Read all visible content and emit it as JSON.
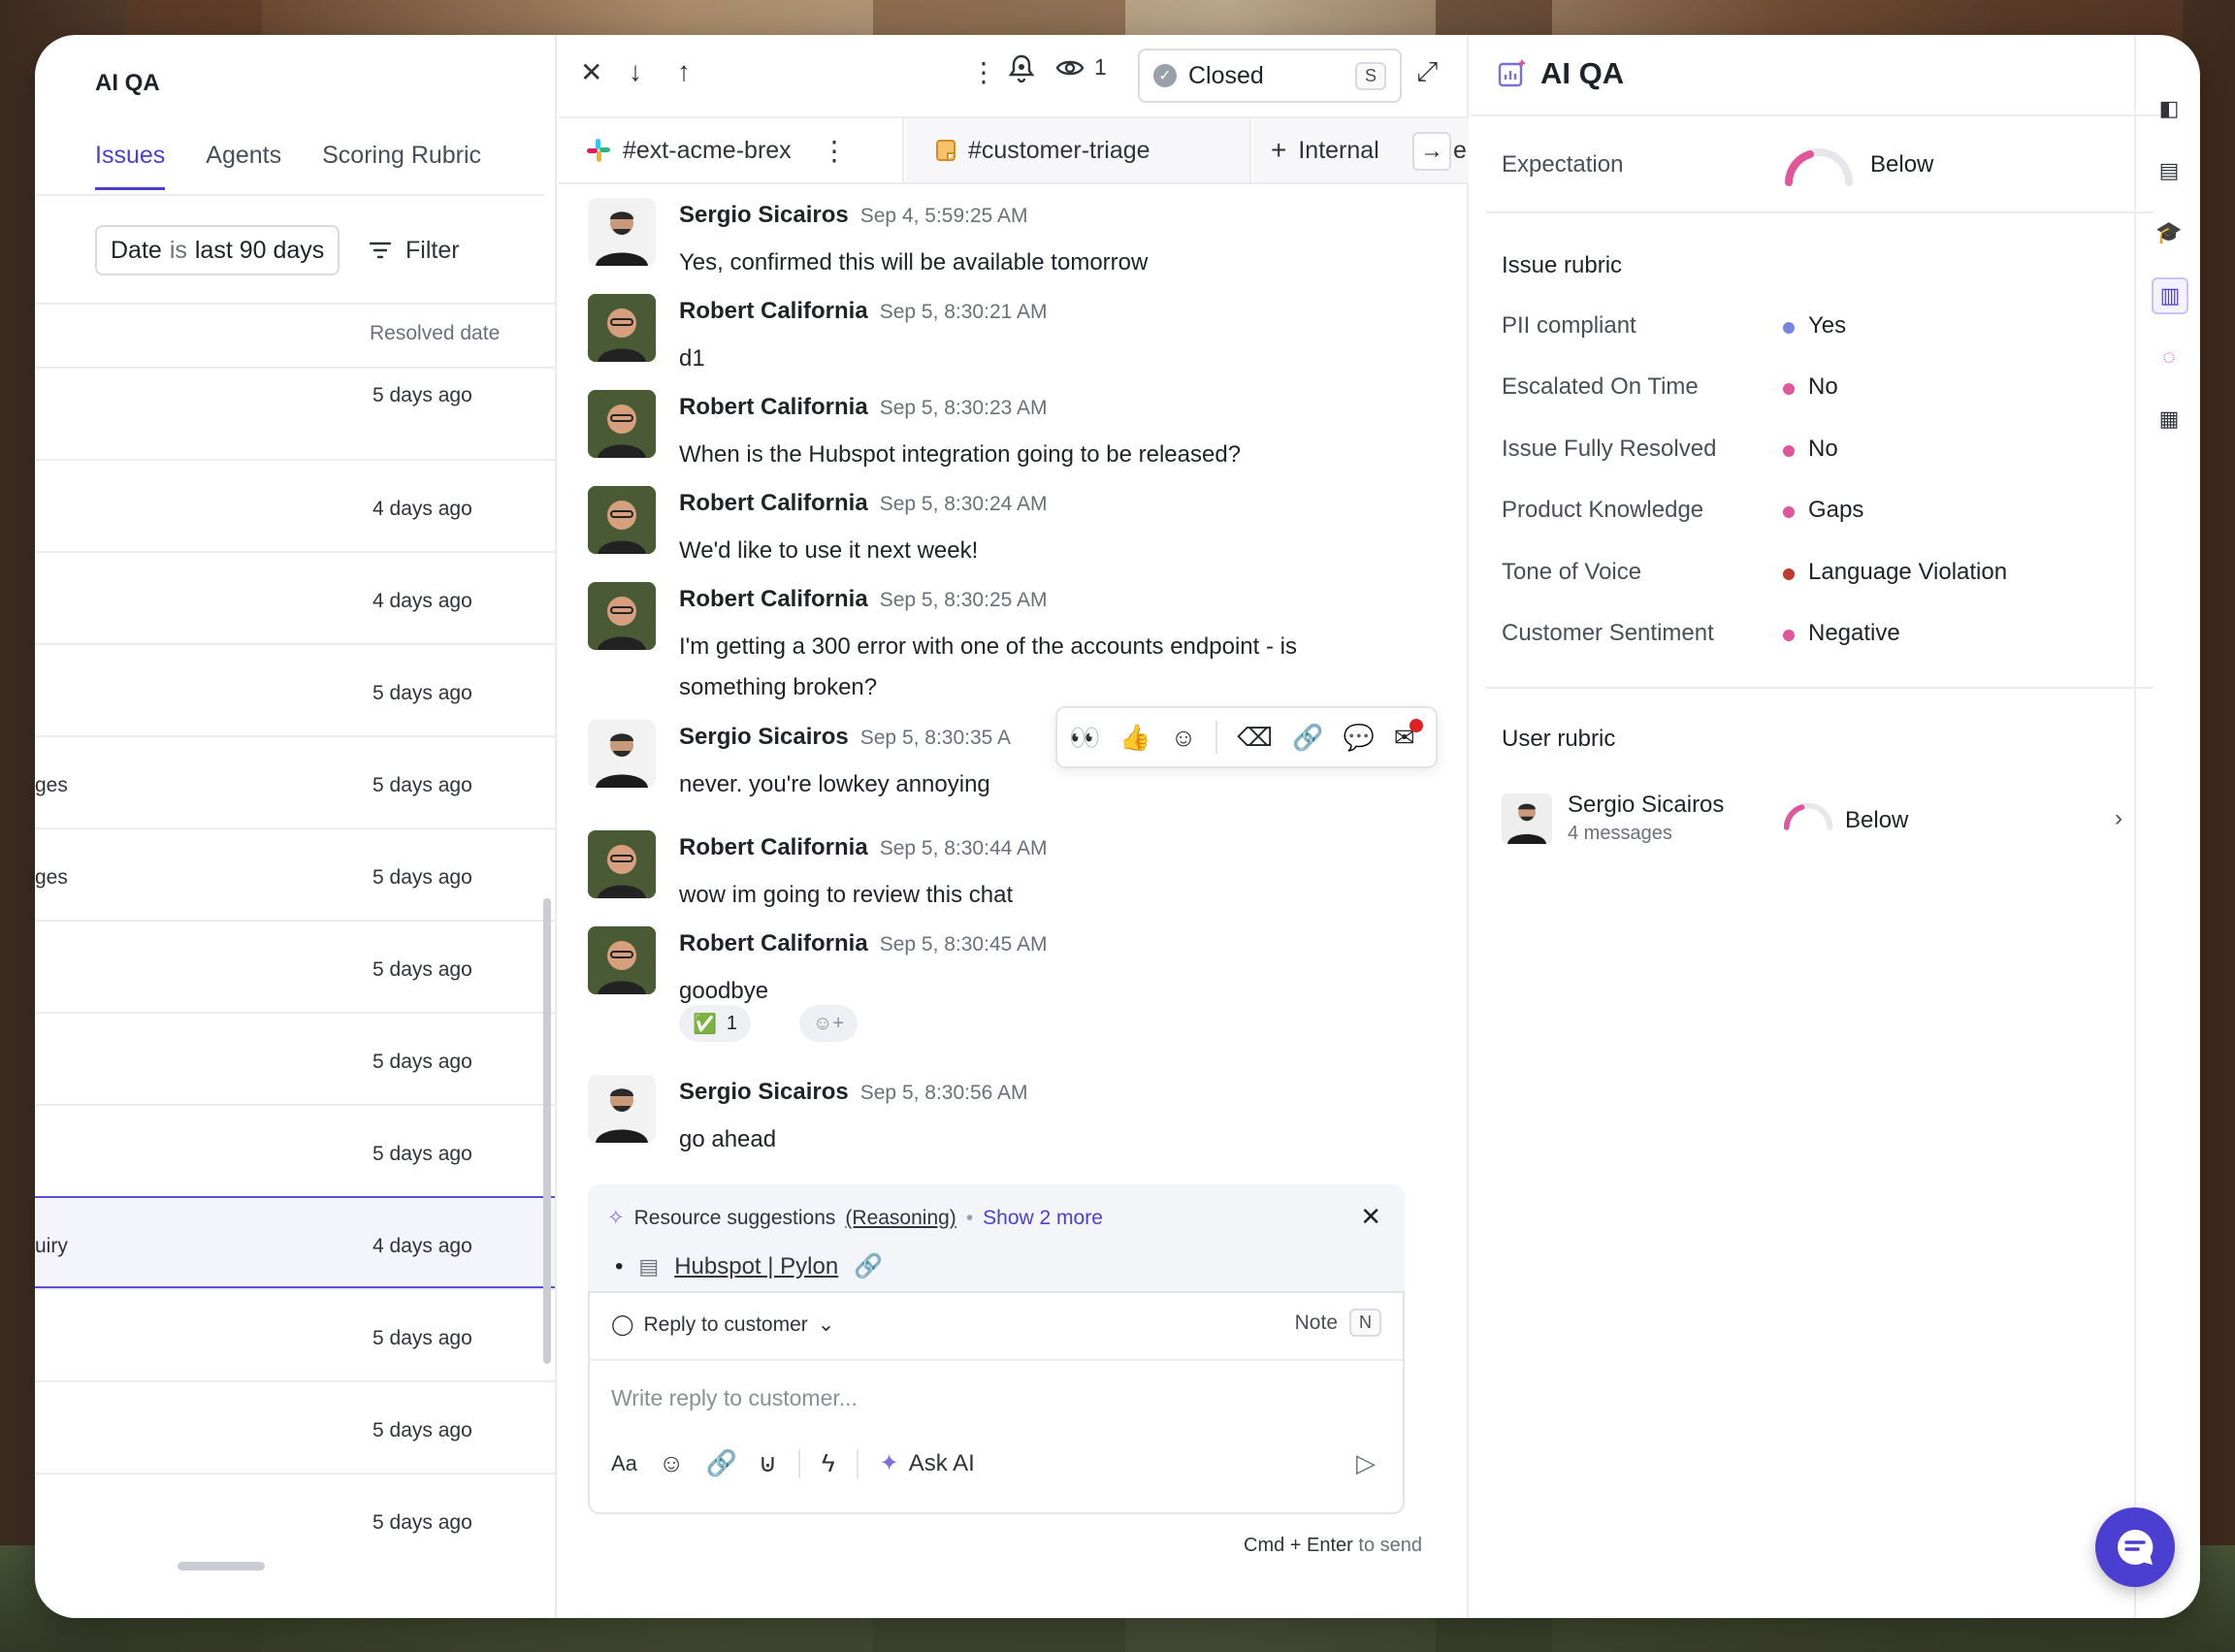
{
  "left": {
    "title": "AI QA",
    "tabs": [
      "Issues",
      "Agents",
      "Scoring Rubric"
    ],
    "date_filter": {
      "field": "Date",
      "op": "is",
      "value": "last 90 days"
    },
    "filter_label": "Filter",
    "column_header": "Resolved date",
    "rows": [
      {
        "frag": "",
        "date": "5 days ago"
      },
      {
        "frag": "",
        "date": "4 days ago"
      },
      {
        "frag": "",
        "date": "4 days ago"
      },
      {
        "frag": "",
        "date": "5 days ago"
      },
      {
        "frag": "ges",
        "date": "5 days ago"
      },
      {
        "frag": "ges",
        "date": "5 days ago"
      },
      {
        "frag": "",
        "date": "5 days ago"
      },
      {
        "frag": "",
        "date": "5 days ago"
      },
      {
        "frag": "",
        "date": "5 days ago"
      },
      {
        "frag": "uiry",
        "date": "4 days ago"
      },
      {
        "frag": "",
        "date": "5 days ago"
      },
      {
        "frag": "",
        "date": "5 days ago"
      },
      {
        "frag": "",
        "date": "5 days ago"
      }
    ]
  },
  "toolbar": {
    "watchers": "1",
    "status": "Closed",
    "status_kbd": "S"
  },
  "channel_tabs": [
    "#ext-acme-brex",
    "#customer-triage",
    "Internal"
  ],
  "internal_tail": "e",
  "messages": [
    {
      "author": "Sergio Sicairos",
      "time": "Sep 4, 5:59:25 AM",
      "text": "Yes, confirmed this will be available tomorrow"
    },
    {
      "author": "Robert California",
      "time": "Sep 5, 8:30:21 AM",
      "text": "d1"
    },
    {
      "author": "Robert California",
      "time": "Sep 5, 8:30:23 AM",
      "text": "When is the Hubspot integration going to be released?"
    },
    {
      "author": "Robert California",
      "time": "Sep 5, 8:30:24 AM",
      "text": "We'd like to use it next week!"
    },
    {
      "author": "Robert California",
      "time": "Sep 5, 8:30:25 AM",
      "text": "I'm getting a 300 error with one of the accounts endpoint - is something broken?"
    },
    {
      "author": "Sergio Sicairos",
      "time": "Sep 5, 8:30:35 A",
      "text": "never. you're lowkey annoying"
    },
    {
      "author": "Robert California",
      "time": "Sep 5, 8:30:44 AM",
      "text": "wow im going to review this chat"
    },
    {
      "author": "Robert California",
      "time": "Sep 5, 8:30:45 AM",
      "text": "goodbye"
    },
    {
      "author": "Sergio Sicairos",
      "time": "Sep 5, 8:30:56 AM",
      "text": "go ahead"
    }
  ],
  "reaction": {
    "emoji": "✅",
    "count": "1"
  },
  "suggestions": {
    "label": "Resource suggestions",
    "reasoning": "(Reasoning)",
    "show_more": "Show 2 more",
    "item": "Hubspot | Pylon"
  },
  "composer": {
    "mode": "Reply to customer",
    "note": "Note",
    "note_kbd": "N",
    "placeholder": "Write reply to customer...",
    "ask_ai": "Ask AI",
    "hint_keys": "Cmd + Enter",
    "hint_rest": "to send"
  },
  "right": {
    "title": "AI QA",
    "expectation_label": "Expectation",
    "expectation_value": "Below",
    "issue_rubric_title": "Issue rubric",
    "issue_rubric": [
      {
        "key": "PII compliant",
        "value": "Yes",
        "color": "#7b83e0"
      },
      {
        "key": "Escalated On Time",
        "value": "No",
        "color": "#e0569a"
      },
      {
        "key": "Issue Fully Resolved",
        "value": "No",
        "color": "#e0569a"
      },
      {
        "key": "Product Knowledge",
        "value": "Gaps",
        "color": "#e0569a"
      },
      {
        "key": "Tone of Voice",
        "value": "Language Violation",
        "color": "#c0392b"
      },
      {
        "key": "Customer Sentiment",
        "value": "Negative",
        "color": "#e0569a"
      }
    ],
    "user_rubric_title": "User rubric",
    "user": {
      "name": "Sergio Sicairos",
      "sub": "4 messages",
      "value": "Below"
    }
  },
  "colors": {
    "accent": "#4b3fd1",
    "gauge": "#e0569a"
  }
}
